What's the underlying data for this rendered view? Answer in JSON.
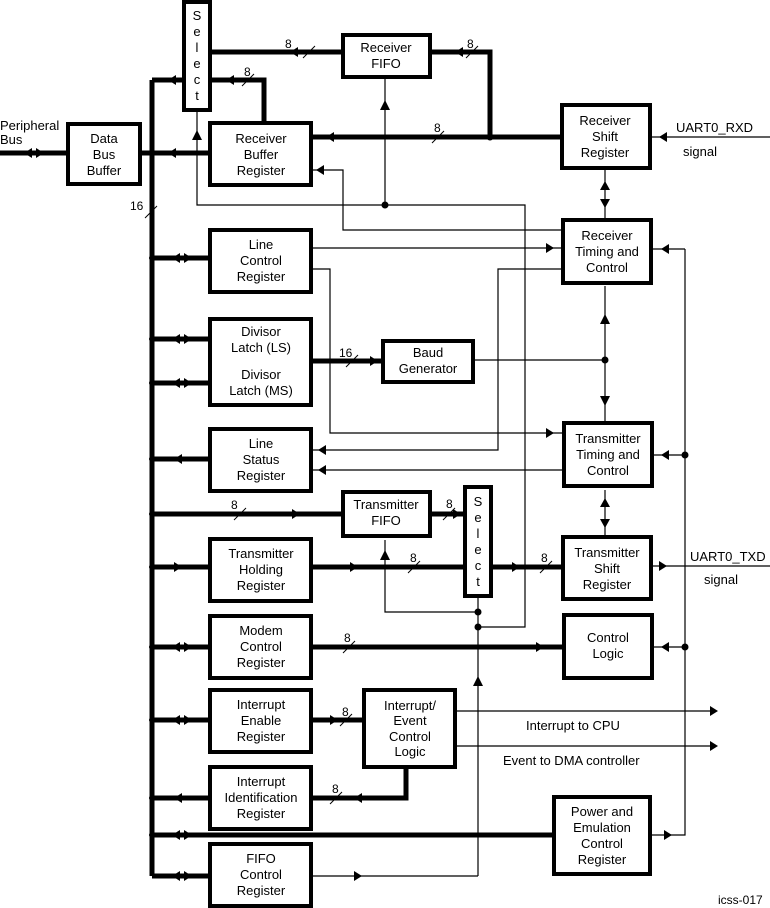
{
  "figure_id": "icss-017",
  "external": {
    "peripheral_bus": [
      "Peripheral",
      "Bus"
    ],
    "rxd_pin": "UART0_RXD",
    "rxd_signal": "signal",
    "txd_pin": "UART0_TXD",
    "txd_signal": "signal",
    "interrupt_out": "Interrupt to CPU",
    "event_out": "Event to DMA controller"
  },
  "blocks": {
    "data_bus_buffer": [
      "Data",
      "Bus",
      "Buffer"
    ],
    "select_rx": [
      "S",
      "e",
      "l",
      "e",
      "c",
      "t"
    ],
    "receiver_fifo": [
      "Receiver",
      "FIFO"
    ],
    "receiver_buffer_register": [
      "Receiver",
      "Buffer",
      "Register"
    ],
    "receiver_shift_register": [
      "Receiver",
      "Shift",
      "Register"
    ],
    "receiver_timing_control": [
      "Receiver",
      "Timing and",
      "Control"
    ],
    "line_control_register": [
      "Line",
      "Control",
      "Register"
    ],
    "divisor_latch_ls": [
      "Divisor",
      "Latch (LS)"
    ],
    "divisor_latch_ms": [
      "Divisor",
      "Latch (MS)"
    ],
    "baud_generator": [
      "Baud",
      "Generator"
    ],
    "line_status_register": [
      "Line",
      "Status",
      "Register"
    ],
    "transmitter_timing_control": [
      "Transmitter",
      "Timing and",
      "Control"
    ],
    "transmitter_fifo": [
      "Transmitter",
      "FIFO"
    ],
    "select_tx": [
      "S",
      "e",
      "l",
      "e",
      "c",
      "t"
    ],
    "transmitter_holding_register": [
      "Transmitter",
      "Holding",
      "Register"
    ],
    "transmitter_shift_register": [
      "Transmitter",
      "Shift",
      "Register"
    ],
    "modem_control_register": [
      "Modem",
      "Control",
      "Register"
    ],
    "control_logic": [
      "Control",
      "Logic"
    ],
    "interrupt_enable_register": [
      "Interrupt",
      "Enable",
      "Register"
    ],
    "interrupt_event_control_logic": [
      "Interrupt/",
      "Event",
      "Control",
      "Logic"
    ],
    "interrupt_identification_register": [
      "Interrupt",
      "Identification",
      "Register"
    ],
    "power_emulation_control_register": [
      "Power and",
      "Emulation",
      "Control",
      "Register"
    ],
    "fifo_control_register": [
      "FIFO",
      "Control",
      "Register"
    ]
  },
  "bus_widths": {
    "main_bus": "16",
    "rx_fifo_to_select": "8",
    "rx_shift_to_fifo": "8",
    "rx_buffer_to_select": "8",
    "rx_shift_to_buffer": "8",
    "divisor_to_baud": "16",
    "bus_to_tx_fifo": "8",
    "tx_fifo_to_select": "8",
    "thr_to_select": "8",
    "select_to_tx_shift": "8",
    "modem_to_control": "8",
    "ier_to_intlogic": "8",
    "intlogic_to_iir": "8"
  }
}
